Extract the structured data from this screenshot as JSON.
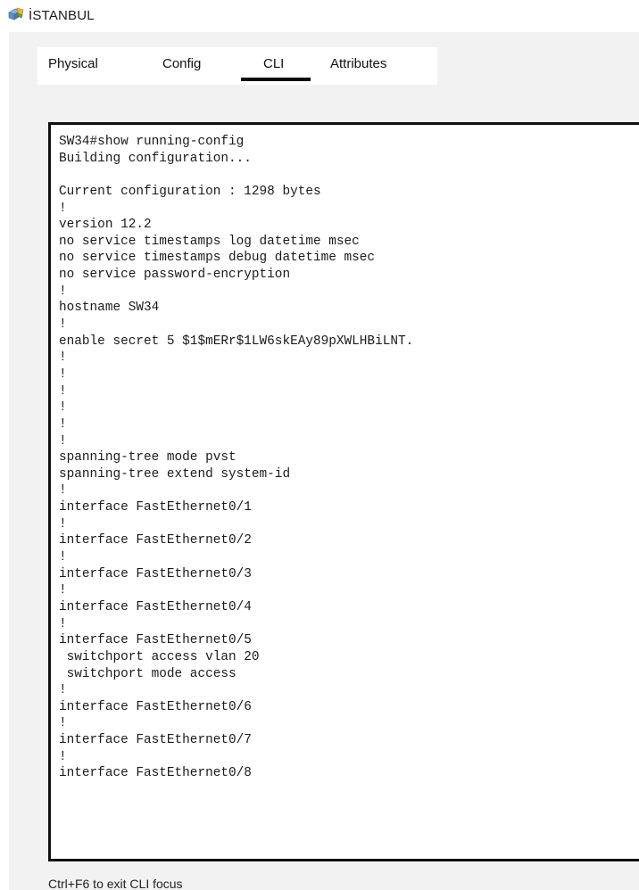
{
  "window": {
    "title": "İSTANBUL",
    "icon": "switch-icon"
  },
  "tabs": [
    {
      "label": "Physical",
      "selected": false
    },
    {
      "label": "Config",
      "selected": false
    },
    {
      "label": "CLI",
      "selected": true
    },
    {
      "label": "Attributes",
      "selected": false
    }
  ],
  "terminal": {
    "lines": [
      "SW34#show running-config",
      "Building configuration...",
      "",
      "Current configuration : 1298 bytes",
      "!",
      "version 12.2",
      "no service timestamps log datetime msec",
      "no service timestamps debug datetime msec",
      "no service password-encryption",
      "!",
      "hostname SW34",
      "!",
      "enable secret 5 $1$mERr$1LW6skEAy89pXWLHBiLNT.",
      "!",
      "!",
      "!",
      "!",
      "!",
      "!",
      "spanning-tree mode pvst",
      "spanning-tree extend system-id",
      "!",
      "interface FastEthernet0/1",
      "!",
      "interface FastEthernet0/2",
      "!",
      "interface FastEthernet0/3",
      "!",
      "interface FastEthernet0/4",
      "!",
      "interface FastEthernet0/5",
      " switchport access vlan 20",
      " switchport mode access",
      "!",
      "interface FastEthernet0/6",
      "!",
      "interface FastEthernet0/7",
      "!",
      "interface FastEthernet0/8"
    ]
  },
  "status": {
    "text": "Ctrl+F6 to exit CLI focus"
  },
  "colors": {
    "panel_background": "#f2f2f2",
    "terminal_border": "#111111",
    "tab_underline": "#0a0a0a"
  }
}
